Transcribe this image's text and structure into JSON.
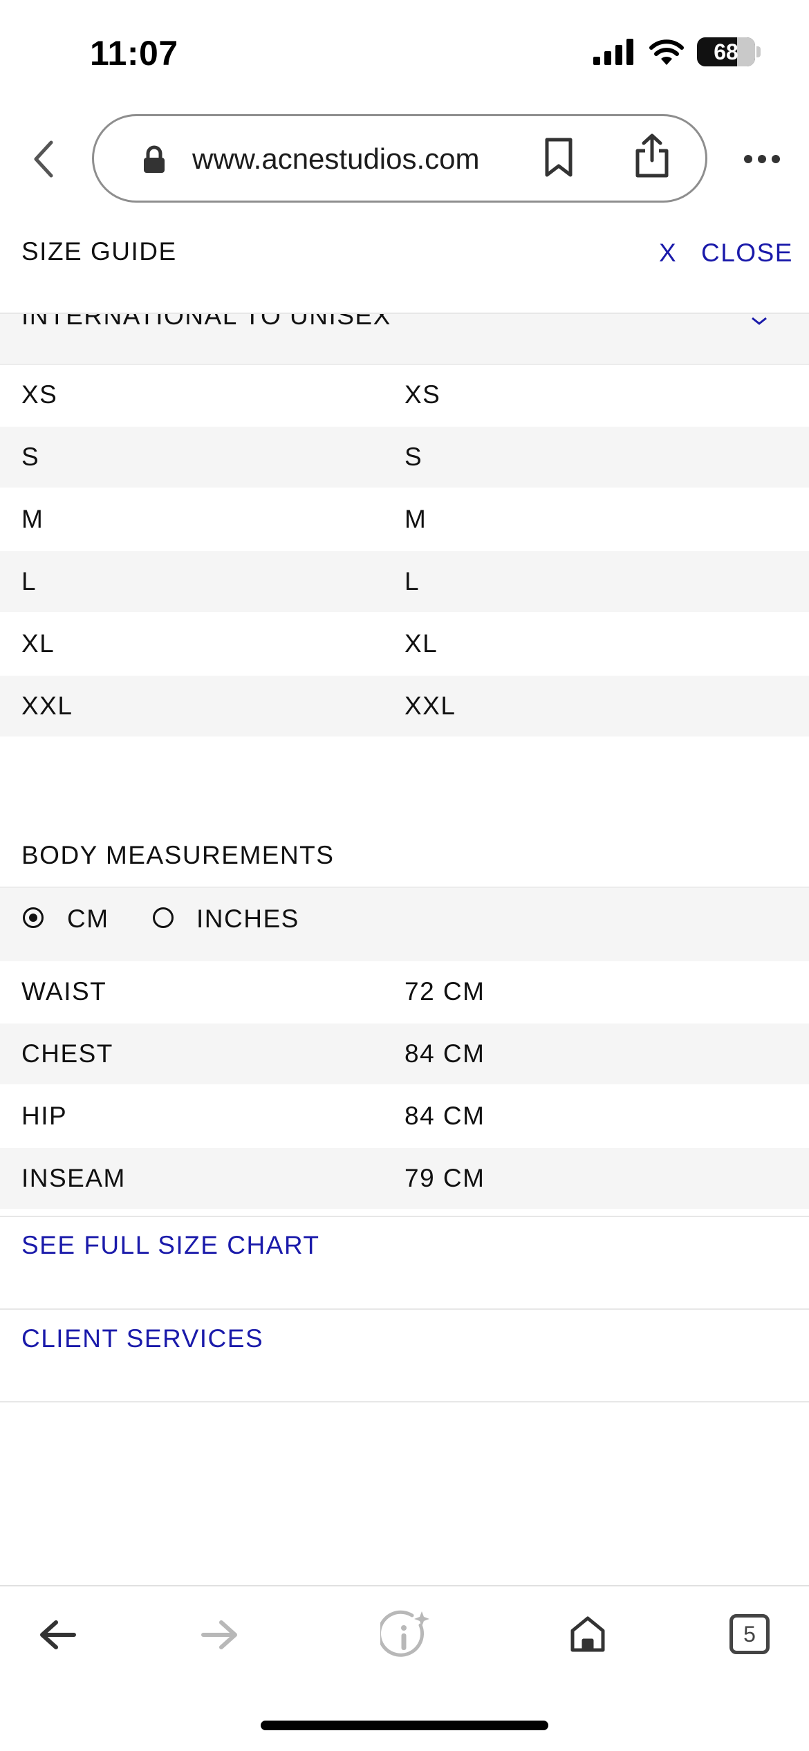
{
  "status_bar": {
    "time": "11:07",
    "battery": "68"
  },
  "browser": {
    "url": "www.acnestudios.com"
  },
  "size_guide": {
    "title": "SIZE GUIDE",
    "close_x": "X",
    "close_label": "CLOSE",
    "conversion_header": "INTERNATIONAL TO UNISEX",
    "rows": [
      {
        "international": "XS",
        "unisex": "XS"
      },
      {
        "international": "S",
        "unisex": "S"
      },
      {
        "international": "M",
        "unisex": "M"
      },
      {
        "international": "L",
        "unisex": "L"
      },
      {
        "international": "XL",
        "unisex": "XL"
      },
      {
        "international": "XXL",
        "unisex": "XXL"
      }
    ]
  },
  "body_measurements": {
    "title": "BODY MEASUREMENTS",
    "units": [
      {
        "label": "CM",
        "selected": true
      },
      {
        "label": "INCHES",
        "selected": false
      }
    ],
    "rows": [
      {
        "name": "WAIST",
        "value": "72 CM"
      },
      {
        "name": "CHEST",
        "value": "84 CM"
      },
      {
        "name": "HIP",
        "value": "84 CM"
      },
      {
        "name": "INSEAM",
        "value": "79 CM"
      }
    ]
  },
  "links": {
    "full_chart": "SEE FULL SIZE CHART",
    "client_services": "CLIENT SERVICES"
  },
  "toolbar": {
    "tab_count": "5"
  },
  "colors": {
    "link": "#1a1aaa",
    "stripe": "#f5f5f5"
  },
  "icons": [
    "signal-icon",
    "wifi-icon",
    "battery-icon",
    "back-chevron-icon",
    "lock-icon",
    "bookmark-icon",
    "share-icon",
    "more-icon",
    "chevron-down-icon",
    "back-arrow-icon",
    "forward-arrow-icon",
    "info-sparkle-icon",
    "home-icon",
    "tabs-icon"
  ]
}
